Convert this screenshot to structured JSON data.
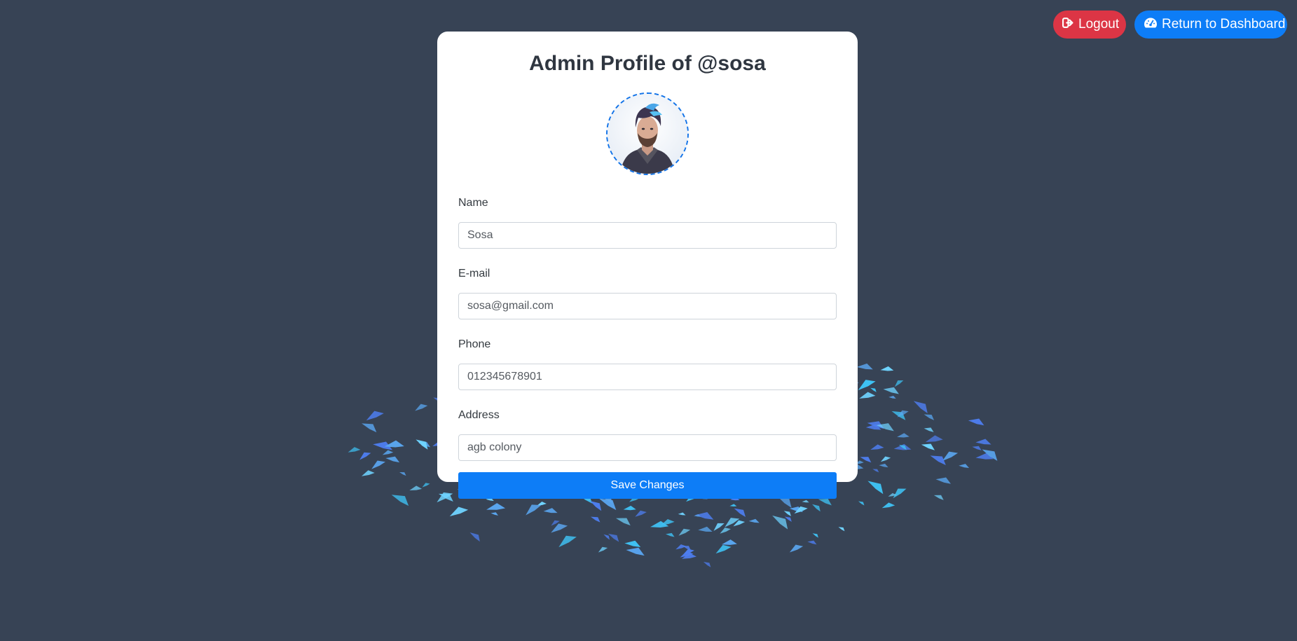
{
  "header": {
    "logout_label": "Logout",
    "dashboard_label": "Return to Dashboard"
  },
  "profile": {
    "title": "Admin Profile of @sosa",
    "avatar_alt": "Admin avatar"
  },
  "form": {
    "name": {
      "label": "Name",
      "value": "Sosa"
    },
    "email": {
      "label": "E-mail",
      "value": "sosa@gmail.com"
    },
    "phone": {
      "label": "Phone",
      "value": "012345678901"
    },
    "address": {
      "label": "Address",
      "value": "agb colony"
    },
    "save_label": "Save Changes"
  },
  "colors": {
    "background": "#374355",
    "logout": "#dc3545",
    "primary": "#0d7df7",
    "avatar_border": "#1273e8",
    "birds": [
      "#3fc3f5",
      "#5aa6f0",
      "#4e7ef0",
      "#6fd3ff"
    ]
  },
  "icons": {
    "logout": "sign-out-icon",
    "dashboard": "tachometer-icon"
  }
}
